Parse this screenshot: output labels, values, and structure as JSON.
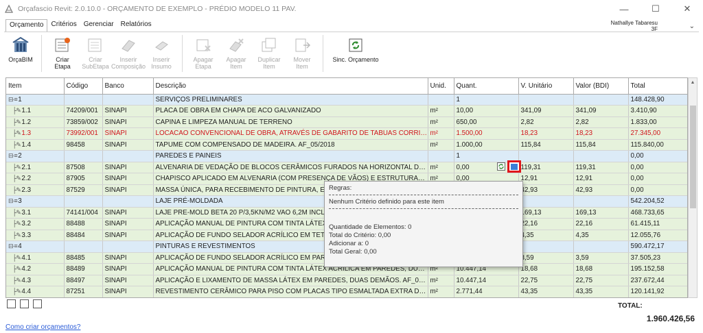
{
  "window": {
    "title": "Orçafascio Revit: 2.0.10.0 - ORÇAMENTO DE EXEMPLO - PRÉDIO MODELO 11 PAV.",
    "minimize": "—",
    "maximize": "☐",
    "close": "✕"
  },
  "tabs": [
    "Orçamento",
    "Critérios",
    "Gerenciar",
    "Relatórios"
  ],
  "user": {
    "name": "Nathallye Tabaresu",
    "sub": "3F"
  },
  "ribbon": {
    "orcabim": "OrçaBIM",
    "criar_etapa": [
      "Criar",
      "Etapa"
    ],
    "criar_subetapa": [
      "Criar",
      "SubEtapa"
    ],
    "inserir_composicao": [
      "Inserir",
      "Composição"
    ],
    "inserir_insumo": [
      "Inserir",
      "Insumo"
    ],
    "apagar_etapa": [
      "Apagar",
      "Etapa"
    ],
    "apagar_item": [
      "Apagar",
      "Item"
    ],
    "duplicar_item": [
      "Duplicar",
      "Item"
    ],
    "mover_item": [
      "Mover",
      "Item"
    ],
    "sinc": "Sinc. Orçamento"
  },
  "columns": [
    "Item",
    "Código",
    "Banco",
    "Descrição",
    "Unid.",
    "Quant.",
    "V. Unitário",
    "Valor (BDI)",
    "Total"
  ],
  "rows": [
    {
      "type": "group",
      "item": "1",
      "codigo": "",
      "banco": "",
      "desc": "SERVIÇOS PRELIMINARES",
      "unid": "",
      "quant": "1",
      "vu": "",
      "vbdi": "",
      "total": "148.428,90"
    },
    {
      "type": "item",
      "item": "1.1",
      "codigo": "74209/001",
      "banco": "SINAPI",
      "desc": "PLACA DE OBRA EM CHAPA DE ACO GALVANIZADO",
      "unid": "m²",
      "quant": "10,00",
      "vu": "341,09",
      "vbdi": "341,09",
      "total": "3.410,90"
    },
    {
      "type": "item",
      "item": "1.2",
      "codigo": "73859/002",
      "banco": "SINAPI",
      "desc": "CAPINA E LIMPEZA MANUAL DE TERRENO",
      "unid": "m²",
      "quant": "650,00",
      "vu": "2,82",
      "vbdi": "2,82",
      "total": "1.833,00"
    },
    {
      "type": "item red",
      "item": "1.3",
      "codigo": "73992/001",
      "banco": "SINAPI",
      "desc": "LOCACAO CONVENCIONAL DE OBRA, ATRAVÉS DE GABARITO DE TABUAS CORRIDAS P...",
      "unid": "m²",
      "quant": "1.500,00",
      "vu": "18,23",
      "vbdi": "18,23",
      "total": "27.345,00"
    },
    {
      "type": "item",
      "item": "1.4",
      "codigo": "98458",
      "banco": "SINAPI",
      "desc": "TAPUME COM COMPENSADO DE MADEIRA. AF_05/2018",
      "unid": "m²",
      "quant": "1.000,00",
      "vu": "115,84",
      "vbdi": "115,84",
      "total": "115.840,00"
    },
    {
      "type": "group",
      "item": "2",
      "codigo": "",
      "banco": "",
      "desc": "PAREDES E PAINEIS",
      "unid": "",
      "quant": "1",
      "vu": "",
      "vbdi": "",
      "total": "0,00"
    },
    {
      "type": "item",
      "item": "2.1",
      "codigo": "87508",
      "banco": "SINAPI",
      "desc": "ALVENARIA DE VEDAÇÃO DE BLOCOS CERÂMICOS FURADOS NA HORIZONTAL DE 9X14...",
      "unid": "m²",
      "quant": "0,00",
      "vu": "119,31",
      "vbdi": "119,31",
      "total": "0,00"
    },
    {
      "type": "item",
      "item": "2.2",
      "codigo": "87905",
      "banco": "SINAPI",
      "desc": "CHAPISCO APLICADO EM ALVENARIA (COM PRESENÇA DE VÃOS) E ESTRUTURAS DE CO...",
      "unid": "m²",
      "quant": "0,00",
      "vu": "12,91",
      "vbdi": "12,91",
      "total": "0,00"
    },
    {
      "type": "item",
      "item": "2.3",
      "codigo": "87529",
      "banco": "SINAPI",
      "desc": "MASSA ÚNICA, PARA RECEBIMENTO DE PINTURA, EM ARGAMASSA",
      "unid": "m²",
      "quant": "",
      "vu": "42,93",
      "vbdi": "42,93",
      "total": "0,00"
    },
    {
      "type": "group",
      "item": "3",
      "codigo": "",
      "banco": "",
      "desc": "LAJE PRÉ-MOLDADA",
      "unid": "",
      "quant": "",
      "vu": "",
      "vbdi": "",
      "total": "542.204,52"
    },
    {
      "type": "item",
      "item": "3.1",
      "codigo": "74141/004",
      "banco": "SINAPI",
      "desc": "LAJE PRE-MOLD BETA 20 P/3,5KN/M2 VAO 6,2M INCL VIGOTAS",
      "unid": "",
      "quant": "",
      "vu": "169,13",
      "vbdi": "169,13",
      "total": "468.733,65"
    },
    {
      "type": "item",
      "item": "3.2",
      "codigo": "88488",
      "banco": "SINAPI",
      "desc": "APLICAÇÃO MANUAL DE PINTURA COM TINTA LÁTEX ACRÍLICA EM TETO",
      "unid": "",
      "quant": "",
      "vu": "22,16",
      "vbdi": "22,16",
      "total": "61.415,11"
    },
    {
      "type": "item",
      "item": "3.3",
      "codigo": "88484",
      "banco": "SINAPI",
      "desc": "APLICAÇÃO DE FUNDO SELADOR ACRÍLICO EM TETO, UMA DEMÃO",
      "unid": "",
      "quant": "",
      "vu": "4,35",
      "vbdi": "4,35",
      "total": "12.055,76"
    },
    {
      "type": "group",
      "item": "4",
      "codigo": "",
      "banco": "",
      "desc": "PINTURAS E REVESTIMENTOS",
      "unid": "",
      "quant": "",
      "vu": "",
      "vbdi": "",
      "total": "590.472,17"
    },
    {
      "type": "item",
      "item": "4.1",
      "codigo": "88485",
      "banco": "SINAPI",
      "desc": "APLICAÇÃO DE FUNDO SELADOR ACRÍLICO EM PAREDES, UMA DEMÃO",
      "unid": "",
      "quant": "",
      "vu": "3,59",
      "vbdi": "3,59",
      "total": "37.505,23"
    },
    {
      "type": "item",
      "item": "4.2",
      "codigo": "88489",
      "banco": "SINAPI",
      "desc": "APLICAÇÃO MANUAL DE PINTURA COM TINTA LÁTEX ACRÍLICA EM PAREDES, DUAS DEM...",
      "unid": "m²",
      "quant": "10.447,14",
      "vu": "18,68",
      "vbdi": "18,68",
      "total": "195.152,58"
    },
    {
      "type": "item",
      "item": "4.3",
      "codigo": "88497",
      "banco": "SINAPI",
      "desc": "APLICAÇÃO E LIXAMENTO DE MASSA LÁTEX EM PAREDES, DUAS DEMÃOS. AF_06/2014",
      "unid": "m²",
      "quant": "10.447,14",
      "vu": "22,75",
      "vbdi": "22,75",
      "total": "237.672,44"
    },
    {
      "type": "item",
      "item": "4.4",
      "codigo": "87251",
      "banco": "SINAPI",
      "desc": "REVESTIMENTO CERÂMICO PARA PISO COM PLACAS TIPO ESMALTADA EXTRA DE DIME...",
      "unid": "m²",
      "quant": "2.771,44",
      "vu": "43,35",
      "vbdi": "43,35",
      "total": "120.141,92"
    }
  ],
  "tooltip": {
    "regras": "Regras:",
    "nenhum": "Nenhum Critério definido para este item",
    "qtd_elementos": "Quantidade de Elementos: 0",
    "total_criterio": "Total do Critério: 0,00",
    "adicionar": "Adicionar a: 0",
    "total_geral": "Total Geral: 0,00"
  },
  "footer": {
    "total_label": "TOTAL:",
    "total_value": "1.960.426,56",
    "help_link": "Como criar orçamentos?"
  },
  "colors": {
    "group_bg": "#dcebf7",
    "item_bg": "#e6f2dc",
    "error_text": "#d0141b",
    "highlight": "#e0161b"
  }
}
